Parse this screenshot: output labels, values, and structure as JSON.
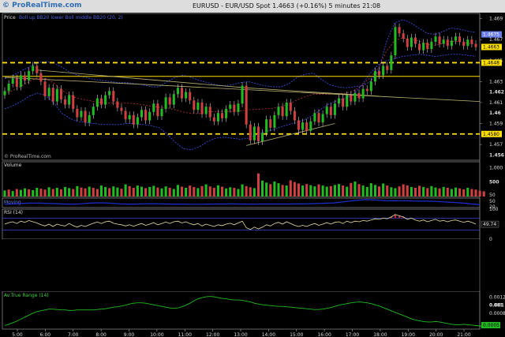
{
  "header": {
    "brand": "© ProRealTime.com",
    "title": "EURUSD - EUR/USD Spot   1.4663 (+0.16%)   5 minutes  21:08"
  },
  "watermark": "© ProRealTime.com",
  "colors": {
    "up": "#22bb22",
    "down": "#d04040",
    "band": "#3a4cd6",
    "hline": "#ffe000",
    "trend": "#b8b070",
    "atr": "#22bb22",
    "vol_line": "#1d2fd0",
    "rsi": "#e8e0a0"
  },
  "chart_data": [
    {
      "type": "candlestick",
      "title": "Price",
      "subtitle": "Boll up BB20 lower Boll middle BB20 (20, 2)",
      "x_ticks": [
        "5:00",
        "6:00",
        "7:00",
        "8:00",
        "9:00",
        "10:00",
        "11:00",
        "12:00",
        "13:00",
        "14:00",
        "15:00",
        "16:00",
        "17:00",
        "18:00",
        "19:00",
        "20:00",
        "21:00"
      ],
      "y_ticks": [
        "1.469",
        "1.467",
        "1.465",
        "1.463",
        "1.461",
        "1.459",
        "1.457"
      ],
      "y_ticks_bold": [
        "1.462",
        "1.46",
        "1.456"
      ],
      "ylim": [
        1.4555,
        1.4695
      ],
      "close_path": [
        1.4621,
        1.4628,
        1.4633,
        1.4625,
        1.4636,
        1.4631,
        1.464,
        1.4645,
        1.4638,
        1.463,
        1.4616,
        1.4624,
        1.4611,
        1.4623,
        1.4613,
        1.4608,
        1.4617,
        1.4604,
        1.4596,
        1.4602,
        1.4591,
        1.4598,
        1.4606,
        1.4614,
        1.4608,
        1.4617,
        1.4621,
        1.4611,
        1.4605,
        1.4602,
        1.4594,
        1.4598,
        1.4589,
        1.4596,
        1.4603,
        1.4593,
        1.4601,
        1.4609,
        1.4597,
        1.4604,
        1.4615,
        1.4608,
        1.4618,
        1.4624,
        1.4614,
        1.462,
        1.4612,
        1.4603,
        1.461,
        1.4599,
        1.4606,
        1.4596,
        1.4592,
        1.46,
        1.4595,
        1.4604,
        1.4608,
        1.4601,
        1.4609,
        1.4626,
        1.4589,
        1.4574,
        1.4587,
        1.4573,
        1.4581,
        1.4594,
        1.4586,
        1.4598,
        1.4606,
        1.4597,
        1.461,
        1.4602,
        1.4593,
        1.4584,
        1.4591,
        1.4583,
        1.4592,
        1.46,
        1.4591,
        1.4599,
        1.4606,
        1.4598,
        1.4609,
        1.4614,
        1.4606,
        1.4617,
        1.4611,
        1.4619,
        1.4614,
        1.4623,
        1.4621,
        1.463,
        1.464,
        1.4636,
        1.4645,
        1.4641,
        1.4655,
        1.4682,
        1.4676,
        1.4671,
        1.4663,
        1.4672,
        1.4666,
        1.466,
        1.4667,
        1.4661,
        1.4668,
        1.4673,
        1.4666,
        1.467,
        1.4664,
        1.4669,
        1.4673,
        1.4668,
        1.4664,
        1.467,
        1.4666,
        1.4663
      ],
      "bb_upper": [
        1.4633,
        1.4636,
        1.464,
        1.4644,
        1.4648,
        1.4649,
        1.4648,
        1.4644,
        1.4639,
        1.4636,
        1.4634,
        1.4632,
        1.4631,
        1.463,
        1.4629,
        1.4629,
        1.4628,
        1.4627,
        1.4625,
        1.4625,
        1.463,
        1.4634,
        1.4636,
        1.4634,
        1.4631,
        1.4629,
        1.4627,
        1.4626,
        1.4627,
        1.4629,
        1.463,
        1.4628,
        1.4626,
        1.4625,
        1.4625,
        1.4628,
        1.4634,
        1.4637,
        1.4638,
        1.4632,
        1.4627,
        1.4625,
        1.4624,
        1.4625,
        1.4626,
        1.463,
        1.464,
        1.4668,
        1.4686,
        1.4689,
        1.4686,
        1.4681,
        1.4676,
        1.4675,
        1.4678,
        1.4681,
        1.468,
        1.4678,
        1.4677
      ],
      "bb_lower": [
        1.4604,
        1.4607,
        1.4611,
        1.4616,
        1.4619,
        1.4617,
        1.461,
        1.46,
        1.4595,
        1.4592,
        1.4591,
        1.459,
        1.4589,
        1.4589,
        1.4589,
        1.459,
        1.459,
        1.4589,
        1.4588,
        1.4586,
        1.458,
        1.4572,
        1.4566,
        1.4565,
        1.4568,
        1.4573,
        1.4576,
        1.4577,
        1.4576,
        1.4575,
        1.4576,
        1.4579,
        1.4582,
        1.4584,
        1.4587,
        1.4589,
        1.4591,
        1.4594,
        1.4598,
        1.4604,
        1.4609,
        1.4612,
        1.4614,
        1.4618,
        1.4627,
        1.4638,
        1.4646,
        1.465,
        1.4652,
        1.4654,
        1.4655,
        1.4656,
        1.4655,
        1.4654,
        1.4655,
        1.4656,
        1.4656,
        1.4655,
        1.4654
      ],
      "horizontal_lines": [
        1.4648,
        1.4635,
        1.458
      ],
      "horizontal_line_labels": [
        "1.4648",
        "1.4580"
      ],
      "trendlines": [
        {
          "from": [
            0,
            1.4634
          ],
          "to": [
            118,
            1.4611
          ]
        },
        {
          "from": [
            8,
            1.4641
          ],
          "to": [
            60,
            1.4624
          ]
        },
        {
          "from": [
            60,
            1.4624
          ],
          "to": [
            93,
            1.4616
          ]
        },
        {
          "from": [
            60,
            1.4569
          ],
          "to": [
            82,
            1.459
          ]
        }
      ],
      "last_value": "1.4663",
      "last_label_2": "1.4675"
    },
    {
      "type": "bar",
      "title": "Volume",
      "y_ticks": [
        "1,000",
        "500",
        "50"
      ],
      "y_ticks_bold": [
        "500"
      ],
      "ylim": [
        0,
        1200
      ],
      "values": [
        210,
        240,
        190,
        260,
        230,
        280,
        250,
        220,
        300,
        270,
        240,
        320,
        260,
        300,
        250,
        330,
        290,
        260,
        360,
        310,
        280,
        340,
        300,
        260,
        380,
        330,
        290,
        350,
        310,
        270,
        420,
        360,
        300,
        380,
        340,
        290,
        330,
        370,
        310,
        280,
        350,
        300,
        260,
        400,
        340,
        300,
        380,
        330,
        290,
        360,
        420,
        350,
        300,
        390,
        340,
        280,
        320,
        300,
        260,
        420,
        360,
        320,
        290,
        800,
        550,
        480,
        430,
        520,
        460,
        400,
        380,
        560,
        500,
        450,
        380,
        430,
        390,
        350,
        420,
        380,
        340,
        360,
        400,
        430,
        380,
        340,
        470,
        520,
        430,
        380,
        330,
        460,
        400,
        350,
        450,
        380,
        320,
        290,
        350,
        420,
        380,
        330,
        300,
        370,
        330,
        290,
        360,
        310,
        280,
        330,
        300,
        260,
        310,
        280,
        250,
        300,
        260,
        240,
        200,
        180
      ],
      "ups": [
        1,
        0,
        1,
        0,
        1,
        1,
        0,
        1,
        1,
        0,
        0,
        1,
        0,
        1,
        0,
        1,
        1,
        0,
        1,
        0,
        0,
        1,
        0,
        0,
        1,
        1,
        0,
        1,
        1,
        0,
        1,
        0,
        0,
        1,
        1,
        0,
        1,
        1,
        0,
        1,
        1,
        0,
        1,
        1,
        0,
        1,
        0,
        0,
        1,
        0,
        1,
        0,
        0,
        1,
        0,
        1,
        1,
        0,
        1,
        1,
        0,
        0,
        1,
        0,
        1,
        1,
        0,
        1,
        1,
        0,
        1,
        0,
        0,
        0,
        1,
        0,
        1,
        1,
        0,
        1,
        1,
        0,
        1,
        1,
        0,
        1,
        0,
        1,
        0,
        1,
        1,
        1,
        1,
        0,
        1,
        0,
        1,
        1,
        0,
        0,
        0,
        1,
        0,
        0,
        1,
        0,
        1,
        1,
        0,
        1,
        0,
        1,
        1,
        0,
        0,
        1,
        0,
        0
      ]
    },
    {
      "type": "line",
      "title": "Moving",
      "y_ticks": [
        "50",
        "20"
      ],
      "ylim": [
        0,
        80
      ],
      "values": [
        28,
        29,
        31,
        33,
        35,
        36,
        37,
        38,
        38,
        37,
        36,
        35,
        34,
        33,
        31,
        30,
        29,
        29,
        30,
        32,
        35,
        37,
        39,
        40,
        40,
        39,
        37,
        35,
        33,
        31,
        30,
        29,
        29,
        30,
        31,
        32,
        33,
        33,
        32,
        31,
        30,
        30,
        29,
        29,
        29,
        29,
        28,
        28,
        28,
        28,
        29,
        29,
        30,
        30,
        30,
        30,
        31,
        31,
        30,
        30,
        29,
        29,
        29,
        30,
        30,
        30,
        30,
        30,
        30,
        30,
        30,
        30,
        31,
        31,
        31,
        32,
        33,
        34,
        35,
        36,
        37,
        38,
        40,
        44,
        48,
        52,
        56,
        60,
        63,
        66,
        67,
        66,
        64,
        62,
        60,
        58,
        57,
        57,
        58,
        58,
        57,
        56,
        55,
        54,
        54,
        54,
        53,
        52,
        50,
        48,
        46,
        44,
        42,
        40,
        37,
        34,
        30,
        27,
        24
      ]
    },
    {
      "type": "line",
      "title": "RSI (14)",
      "y_ticks": [
        "100",
        "50",
        "0"
      ],
      "y_ticks_bold": [
        "49.74"
      ],
      "ylim": [
        0,
        100
      ],
      "levels": [
        70,
        30
      ],
      "values": [
        50,
        55,
        58,
        52,
        60,
        56,
        62,
        58,
        54,
        48,
        44,
        50,
        42,
        50,
        46,
        44,
        52,
        45,
        40,
        46,
        42,
        48,
        53,
        57,
        52,
        58,
        60,
        53,
        50,
        48,
        44,
        48,
        43,
        48,
        52,
        46,
        50,
        55,
        48,
        52,
        57,
        52,
        58,
        60,
        54,
        58,
        52,
        48,
        52,
        44,
        50,
        46,
        42,
        48,
        45,
        50,
        53,
        48,
        54,
        60,
        38,
        32,
        40,
        34,
        40,
        48,
        44,
        52,
        56,
        50,
        58,
        52,
        46,
        42,
        46,
        42,
        48,
        52,
        46,
        50,
        55,
        50,
        56,
        58,
        52,
        60,
        55,
        60,
        58,
        62,
        60,
        64,
        68,
        66,
        70,
        68,
        74,
        82,
        78,
        74,
        66,
        70,
        64,
        60,
        64,
        58,
        62,
        66,
        60,
        62,
        58,
        62,
        64,
        60,
        56,
        60,
        56,
        50
      ]
    },
    {
      "type": "area",
      "title": "Av.True Range (14)",
      "y_ticks": [
        "0.0012",
        "0.001",
        "0.0008"
      ],
      "y_ticks_bold": [
        "0.001",
        "0.0005"
      ],
      "ylim": [
        0.0004,
        0.00135
      ],
      "values": [
        0.00049,
        0.00052,
        0.00056,
        0.0006,
        0.00065,
        0.0007,
        0.00075,
        0.0008,
        0.00084,
        0.00086,
        0.00088,
        0.0009,
        0.0009,
        0.00089,
        0.00088,
        0.00088,
        0.00087,
        0.00087,
        0.00088,
        0.00088,
        0.00088,
        0.00088,
        0.00088,
        0.00089,
        0.0009,
        0.00091,
        0.00093,
        0.00095,
        0.00096,
        0.00098,
        0.001,
        0.00103,
        0.00105,
        0.00106,
        0.00106,
        0.00105,
        0.00103,
        0.00101,
        0.00099,
        0.00097,
        0.00095,
        0.00093,
        0.00092,
        0.00093,
        0.00096,
        0.001,
        0.00105,
        0.00111,
        0.00116,
        0.00119,
        0.00121,
        0.00122,
        0.00121,
        0.00119,
        0.00117,
        0.00116,
        0.00114,
        0.00113,
        0.00113,
        0.00112,
        0.0011,
        0.00108,
        0.00105,
        0.00103,
        0.00101,
        0.001,
        0.00099,
        0.00098,
        0.00097,
        0.00097,
        0.00096,
        0.00095,
        0.00094,
        0.00093,
        0.00092,
        0.00091,
        0.0009,
        0.00089,
        0.00089,
        0.0009,
        0.00092,
        0.00094,
        0.00097,
        0.001,
        0.00102,
        0.00104,
        0.00106,
        0.00107,
        0.00108,
        0.00107,
        0.00106,
        0.00104,
        0.00101,
        0.00098,
        0.00094,
        0.0009,
        0.00086,
        0.00082,
        0.00078,
        0.00074,
        0.0007,
        0.00066,
        0.00063,
        0.00061,
        0.00059,
        0.00058,
        0.00058,
        0.00059,
        0.00058,
        0.00056,
        0.00054,
        0.00052,
        0.00051,
        0.00051,
        0.00052,
        0.00051,
        0.0005,
        0.00049,
        0.00048,
        0.00047
      ],
      "last_value": "0.0005"
    }
  ]
}
